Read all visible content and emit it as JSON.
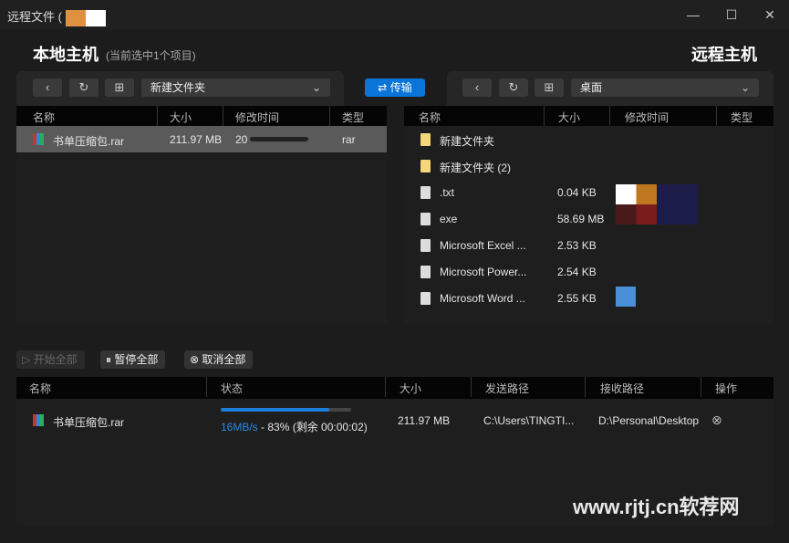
{
  "window": {
    "title": "远程文件 (",
    "min": "—",
    "max": "☐",
    "close": "✕"
  },
  "local": {
    "title": "本地主机",
    "subtitle": "(当前选中1个项目)",
    "path": "新建文件夹",
    "columns": [
      "名称",
      "大小",
      "修改时间",
      "类型"
    ],
    "rows": [
      {
        "name": "书单压缩包.rar",
        "size": "211.97 MB",
        "modified": "20",
        "type": "rar",
        "selected": true
      }
    ]
  },
  "transfer_button": "传输",
  "remote": {
    "title": "远程主机",
    "path": "桌面",
    "columns": [
      "名称",
      "大小",
      "修改时间",
      "类型"
    ],
    "rows": [
      {
        "name": "新建文件夹",
        "size": "",
        "icon": "folder-icon"
      },
      {
        "name": "新建文件夹 (2)",
        "size": "",
        "icon": "folder-icon"
      },
      {
        "name": ".txt",
        "size": "0.04 KB",
        "icon": "text-file-icon"
      },
      {
        "name": "exe",
        "size": "58.69 MB",
        "icon": "exe-icon"
      },
      {
        "name": "Microsoft Excel ...",
        "size": "2.53 KB",
        "icon": "shortcut-icon"
      },
      {
        "name": "Microsoft Power...",
        "size": "2.54 KB",
        "icon": "shortcut-icon"
      },
      {
        "name": "Microsoft Word ...",
        "size": "2.55 KB",
        "icon": "shortcut-icon"
      }
    ]
  },
  "queue": {
    "start_all": "开始全部",
    "pause_all": "暂停全部",
    "cancel_all": "取消全部",
    "columns": [
      "名称",
      "状态",
      "大小",
      "发送路径",
      "接收路径",
      "操作"
    ],
    "rows": [
      {
        "name": "书单压缩包.rar",
        "speed": "16MB/s",
        "status": " - 83% (剩余 00:00:02)",
        "progress": 83,
        "size": "211.97 MB",
        "from": "C:\\Users\\TINGTI...",
        "to": "D:\\Personal\\Desktop"
      }
    ]
  },
  "watermark": "www.rjtj.cn软荐网",
  "colors": {
    "accent": "#0a74d9",
    "selected_row": "#5a5a5a"
  }
}
